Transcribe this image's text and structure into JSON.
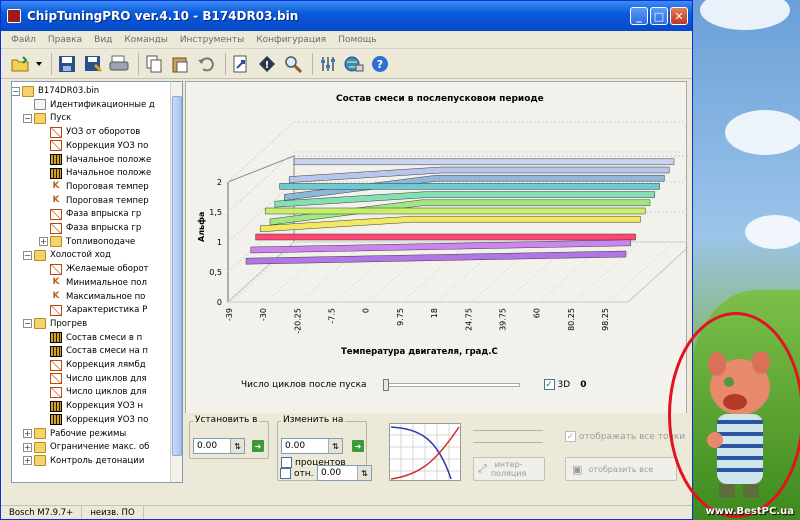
{
  "window": {
    "title": "ChipTuningPRO ver.4.10 - B174DR03.bin",
    "controls": {
      "minimize": "_",
      "maximize": "□",
      "close": "✕"
    }
  },
  "menu": [
    "Файл",
    "Правка",
    "Вид",
    "Команды",
    "Инструменты",
    "Конфигурация",
    "Помощь"
  ],
  "toolbar": {
    "icons": [
      "open-folder-icon",
      "save-icon",
      "save-as-icon",
      "print-icon",
      "copy-icon",
      "paste-icon",
      "undo-icon",
      "export-icon",
      "info-icon",
      "search-icon",
      "settings-icon",
      "network-icon",
      "help-icon"
    ]
  },
  "tree": {
    "rows": [
      {
        "label": "B174DR03.bin",
        "icon": "folder",
        "level": 0,
        "exp": "−"
      },
      {
        "label": "Идентификационные д",
        "icon": "doc",
        "level": 1
      },
      {
        "label": "Пуск",
        "icon": "folder",
        "level": 1,
        "exp": "−"
      },
      {
        "label": "УОЗ от оборотов",
        "icon": "map2d",
        "level": 2
      },
      {
        "label": "Коррекция УОЗ по",
        "icon": "map2d",
        "level": 2
      },
      {
        "label": "Начальное положе",
        "icon": "map3d",
        "level": 2
      },
      {
        "label": "Начальное положе",
        "icon": "map3d",
        "level": 2
      },
      {
        "label": "Пороговая темпер",
        "icon": "k",
        "level": 2
      },
      {
        "label": "Пороговая темпер",
        "icon": "k",
        "level": 2
      },
      {
        "label": "Фаза впрыска гр",
        "icon": "map2d",
        "level": 2
      },
      {
        "label": "Фаза впрыска гр",
        "icon": "map2d",
        "level": 2
      },
      {
        "label": "Топливоподаче",
        "icon": "folder",
        "level": 2,
        "exp": "+"
      },
      {
        "label": "Холостой ход",
        "icon": "folder",
        "level": 1,
        "exp": "−"
      },
      {
        "label": "Желаемые оборот",
        "icon": "map2d",
        "level": 2
      },
      {
        "label": "Минимальное пол",
        "icon": "k",
        "level": 2
      },
      {
        "label": "Максимальное по",
        "icon": "k",
        "level": 2
      },
      {
        "label": "Характеристика Р",
        "icon": "map2d",
        "level": 2
      },
      {
        "label": "Прогрев",
        "icon": "folder",
        "level": 1,
        "exp": "−"
      },
      {
        "label": "Состав смеси в п",
        "icon": "map3d",
        "level": 2
      },
      {
        "label": "Состав смеси на п",
        "icon": "map3d",
        "level": 2
      },
      {
        "label": "Коррекция лямбд",
        "icon": "map2d",
        "level": 2
      },
      {
        "label": "Число циклов для",
        "icon": "map2d",
        "level": 2
      },
      {
        "label": "Число циклов для",
        "icon": "map2d",
        "level": 2
      },
      {
        "label": "Коррекция УОЗ н",
        "icon": "map3d",
        "level": 2
      },
      {
        "label": "Коррекция УОЗ по",
        "icon": "map3d",
        "level": 2
      },
      {
        "label": "Рабочие режимы",
        "icon": "folder",
        "level": 1,
        "exp": "+"
      },
      {
        "label": "Ограничение макс. об",
        "icon": "folder",
        "level": 1,
        "exp": "+"
      },
      {
        "label": "Контроль детонации",
        "icon": "folder",
        "level": 1,
        "exp": "+"
      }
    ]
  },
  "chart_data": {
    "type": "surface",
    "title": "Состав смеси в послепусковом периоде",
    "xlabel": "Температура двигателя, град.С",
    "ylabel": "Альфа",
    "x_ticks": [
      "-39",
      "-30",
      "-20.25",
      "-7.5",
      "0",
      "9.75",
      "18",
      "24.75",
      "39.75",
      "60",
      "80.25",
      "98.25"
    ],
    "y_ticks": [
      "0",
      "0,5",
      "1",
      "1,5",
      "2"
    ],
    "ylim": [
      0,
      2
    ],
    "z_ticks_visible": false,
    "series_colors": [
      "#c9d4f0",
      "#b6c4ec",
      "#8ab4dc",
      "#6acad0",
      "#7ee0b0",
      "#9be87e",
      "#c8ef6a",
      "#f0e95a",
      "#ff3d6c",
      "#c980f0",
      "#b06ee6"
    ]
  },
  "cycle_slider": {
    "label": "Число циклов после пуска",
    "value": "0"
  },
  "check_3d": {
    "label": "3D",
    "checked": true
  },
  "controls": {
    "set_label": "Установить в",
    "set_value": "0.00",
    "change_label": "Изменить на",
    "change_value": "0.00",
    "percent_label": "процентов",
    "rel_label": "отн.",
    "rel_value": "0.00",
    "interp_label_1": "интер-",
    "interp_label_2": "поляция",
    "show_all_points": "отображать все точки",
    "show_all_button": "отобразить все"
  },
  "statusbar": [
    "Bosch M7.9.7+",
    "неизв. ПО"
  ],
  "watermark": "www.BestPC.ua"
}
